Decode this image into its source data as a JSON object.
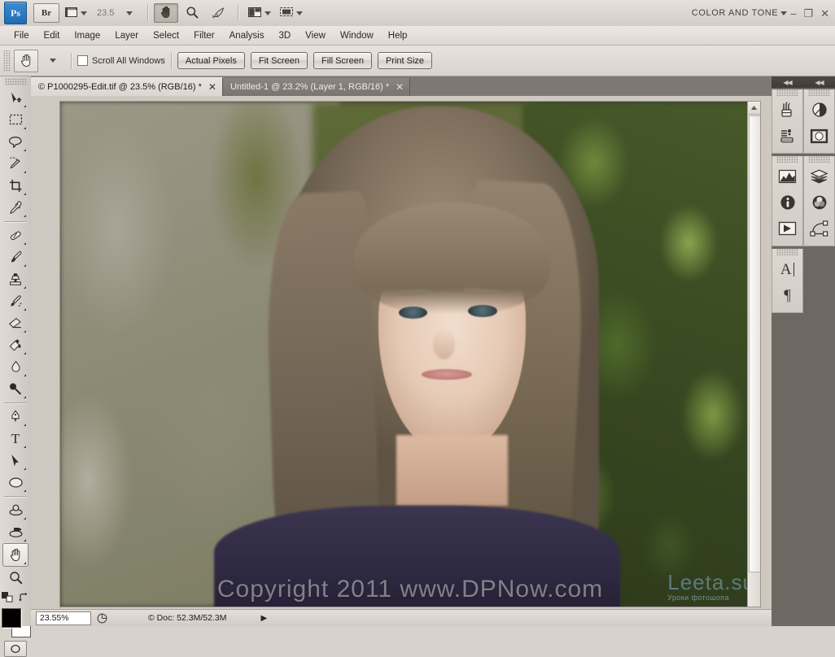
{
  "app": {
    "name": "Adobe Photoshop",
    "logo_text": "Ps",
    "bridge_label": "Br",
    "zoom_level": "23.5",
    "workspace_name": "COLOR AND TONE",
    "window_controls": {
      "minimize": "–",
      "maximize": "❐",
      "close": "✕"
    },
    "icons": {
      "bridge": "bridge-icon",
      "view_extras": "view-extras-icon",
      "hand": "hand-tool-icon",
      "zoom": "zoom-tool-icon",
      "rotate_view": "rotate-view-icon",
      "arrange_documents": "arrange-documents-icon",
      "screen_mode": "screen-mode-icon"
    }
  },
  "menubar": {
    "items": [
      {
        "label": "File"
      },
      {
        "label": "Edit"
      },
      {
        "label": "Image"
      },
      {
        "label": "Layer"
      },
      {
        "label": "Select"
      },
      {
        "label": "Filter"
      },
      {
        "label": "Analysis"
      },
      {
        "label": "3D"
      },
      {
        "label": "View"
      },
      {
        "label": "Window"
      },
      {
        "label": "Help"
      }
    ]
  },
  "options_bar": {
    "active_tool": "Hand Tool",
    "scroll_all_windows_label": "Scroll All Windows",
    "scroll_all_windows_checked": false,
    "buttons": [
      {
        "label": "Actual Pixels"
      },
      {
        "label": "Fit Screen"
      },
      {
        "label": "Fill Screen"
      },
      {
        "label": "Print Size"
      }
    ]
  },
  "tabs": [
    {
      "label": "© P1000295-Edit.tif @ 23.5% (RGB/16) *",
      "active": true,
      "close": "✕"
    },
    {
      "label": "Untitled-1 @ 23.2% (Layer 1, RGB/16) *",
      "active": false,
      "close": "✕"
    }
  ],
  "toolbar": {
    "tools": [
      {
        "name": "move-tool",
        "selected": false,
        "has_flyout": true
      },
      {
        "name": "rectangular-marquee-tool",
        "selected": false,
        "has_flyout": true
      },
      {
        "name": "lasso-tool",
        "selected": false,
        "has_flyout": true
      },
      {
        "name": "quick-selection-tool",
        "selected": false,
        "has_flyout": true
      },
      {
        "name": "crop-tool",
        "selected": false,
        "has_flyout": true
      },
      {
        "name": "eyedropper-tool",
        "selected": false,
        "has_flyout": true
      },
      {
        "name": "spot-healing-brush-tool",
        "selected": false,
        "has_flyout": true
      },
      {
        "name": "brush-tool",
        "selected": false,
        "has_flyout": true
      },
      {
        "name": "clone-stamp-tool",
        "selected": false,
        "has_flyout": true
      },
      {
        "name": "history-brush-tool",
        "selected": false,
        "has_flyout": true
      },
      {
        "name": "eraser-tool",
        "selected": false,
        "has_flyout": true
      },
      {
        "name": "gradient-tool",
        "selected": false,
        "has_flyout": true
      },
      {
        "name": "blur-tool",
        "selected": false,
        "has_flyout": true
      },
      {
        "name": "dodge-tool",
        "selected": false,
        "has_flyout": true
      },
      {
        "name": "pen-tool",
        "selected": false,
        "has_flyout": true
      },
      {
        "name": "horizontal-type-tool",
        "selected": false,
        "has_flyout": true
      },
      {
        "name": "path-selection-tool",
        "selected": false,
        "has_flyout": true
      },
      {
        "name": "ellipse-shape-tool",
        "selected": false,
        "has_flyout": true
      },
      {
        "name": "3d-object-rotate-tool",
        "selected": false,
        "has_flyout": true
      },
      {
        "name": "3d-camera-rotate-tool",
        "selected": false,
        "has_flyout": true
      },
      {
        "name": "hand-tool",
        "selected": true,
        "has_flyout": true
      },
      {
        "name": "zoom-tool",
        "selected": false,
        "has_flyout": false
      }
    ],
    "foreground_color": "#000000",
    "background_color": "#ffffff",
    "quick_mask_name": "quick-mask-mode"
  },
  "canvas": {
    "watermark": "Copyright 2011 www.DPNow.com",
    "brand_logo": "Leeta.su",
    "brand_tagline": "Уроки фотошопа",
    "background_color": "#cfc8c1"
  },
  "status_bar": {
    "zoom_value": "23.55%",
    "doc_info": "© Doc: 52.3M/52.3M",
    "expand_arrow": "▶"
  },
  "dock": {
    "collapse_left": "◀◀",
    "collapse_right": "◀◀",
    "groups": [
      {
        "column": "left",
        "panels": [
          {
            "name": "brush-panel-icon"
          },
          {
            "name": "brush-presets-panel-icon"
          }
        ]
      },
      {
        "column": "right",
        "panels": [
          {
            "name": "adjustments-panel-icon"
          },
          {
            "name": "masks-panel-icon"
          }
        ]
      },
      {
        "column": "left",
        "panels": [
          {
            "name": "histogram-panel-icon"
          },
          {
            "name": "info-panel-icon"
          },
          {
            "name": "actions-panel-icon"
          }
        ]
      },
      {
        "column": "right",
        "panels": [
          {
            "name": "layers-panel-icon"
          },
          {
            "name": "channels-panel-icon"
          },
          {
            "name": "paths-panel-icon"
          }
        ]
      },
      {
        "column": "left",
        "panels": [
          {
            "name": "character-panel-icon"
          },
          {
            "name": "paragraph-panel-icon"
          }
        ]
      }
    ]
  }
}
